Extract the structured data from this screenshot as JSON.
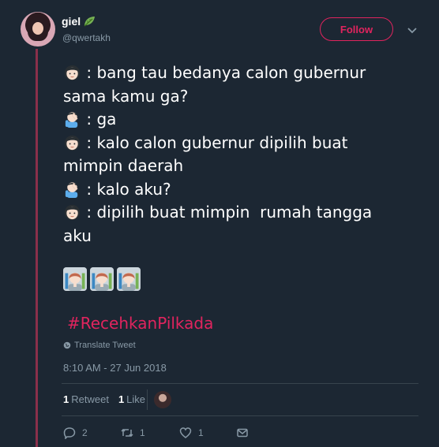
{
  "user": {
    "display_name": "giel",
    "handle": "@qwertakh"
  },
  "follow_label": "Follow",
  "tweet": {
    "lines": [
      {
        "emoji": "woman-face",
        "text": " : bang tau bedanya calon gubernur"
      },
      {
        "emoji": "",
        "text": "sama kamu ga?"
      },
      {
        "emoji": "man-facepalming",
        "text": " : ga"
      },
      {
        "emoji": "woman-face",
        "text": " : kalo calon gubernur dipilih buat"
      },
      {
        "emoji": "",
        "text": "mimpin daerah"
      },
      {
        "emoji": "man-facepalming",
        "text": " : kalo aku?"
      },
      {
        "emoji": "woman-face",
        "text": " : dipilih buat mimpin  rumah tangga"
      },
      {
        "emoji": "",
        "text": "aku"
      }
    ],
    "emoji_row": [
      "woman-office-worker",
      "woman-office-worker",
      "woman-office-worker"
    ],
    "hashtag": "#RecehkanPilkada"
  },
  "translate_label": "Translate Tweet",
  "timestamp": "8:10 AM - 27 Jun 2018",
  "stats": {
    "retweets_count": "1",
    "retweets_label": "Retweet",
    "likes_count": "1",
    "likes_label": "Like"
  },
  "actions": {
    "reply_count": "2",
    "retweet_count": "1",
    "like_count": "1"
  },
  "colors": {
    "background": "#1c2733",
    "accent": "#e0245e",
    "muted": "#8899a6",
    "thread_line": "#8a2f4a"
  }
}
